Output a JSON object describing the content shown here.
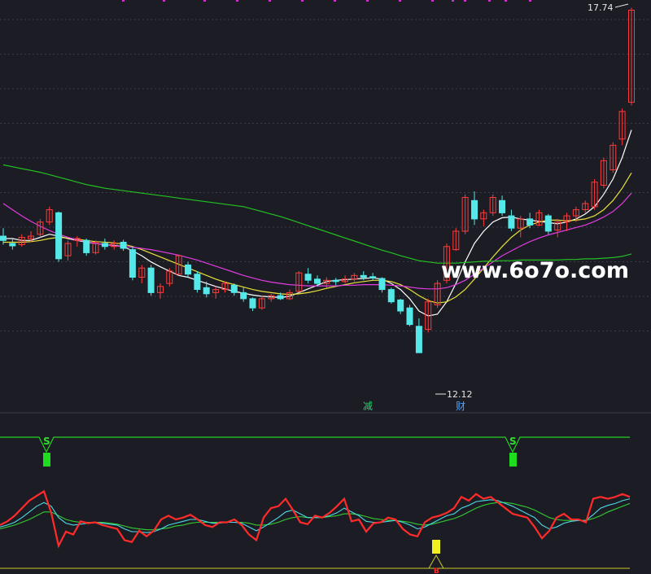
{
  "colors": {
    "background": "#1c1d24",
    "up_candle": "#ff3b3b",
    "down_candle": "#54e8e8",
    "ma5": "#ffffff",
    "ma10": "#e8e23a",
    "ma20": "#e03ce0",
    "ma60": "#22c122",
    "grid": "#3a3c48",
    "osc_main": "#ff2a2a",
    "osc_fast": "#4fd8e6",
    "osc_slow": "#33cc33",
    "signal_line": "#22d022",
    "signal_bar": "#1edc1e",
    "bottom_line": "#c9c92a",
    "bottom_marker": "#f0f020",
    "markers_top": "#cc33cc"
  },
  "labels": {
    "high_price": "17.74",
    "low_price": "12.12",
    "event_1": "减",
    "event_2": "财",
    "signal_1": "S",
    "signal_2": "S",
    "bottom_tag": "B",
    "watermark": "www.6o7o.com"
  },
  "chart_data": [
    {
      "type": "candlestick",
      "title": "",
      "series": [
        {
          "name": "K",
          "kind": "ohlc",
          "values": [
            [
              14.02,
              14.15,
              13.88,
              13.95
            ],
            [
              13.9,
              13.98,
              13.8,
              13.86
            ],
            [
              13.88,
              14.05,
              13.85,
              14.0
            ],
            [
              13.98,
              14.1,
              13.92,
              14.02
            ],
            [
              14.05,
              14.3,
              14.0,
              14.25
            ],
            [
              14.25,
              14.5,
              14.2,
              14.45
            ],
            [
              14.4,
              14.42,
              13.6,
              13.65
            ],
            [
              13.7,
              13.95,
              13.62,
              13.9
            ],
            [
              13.95,
              14.02,
              13.85,
              13.98
            ],
            [
              13.95,
              13.98,
              13.7,
              13.75
            ],
            [
              13.75,
              13.95,
              13.72,
              13.92
            ],
            [
              13.9,
              13.98,
              13.8,
              13.85
            ],
            [
              13.85,
              13.95,
              13.8,
              13.9
            ],
            [
              13.92,
              13.96,
              13.78,
              13.82
            ],
            [
              13.8,
              13.85,
              13.3,
              13.35
            ],
            [
              13.35,
              13.55,
              13.25,
              13.5
            ],
            [
              13.5,
              13.55,
              13.05,
              13.1
            ],
            [
              13.1,
              13.25,
              13.0,
              13.2
            ],
            [
              13.25,
              13.5,
              13.2,
              13.45
            ],
            [
              13.4,
              13.72,
              13.38,
              13.7
            ],
            [
              13.55,
              13.6,
              13.35,
              13.4
            ],
            [
              13.4,
              13.45,
              13.1,
              13.15
            ],
            [
              13.18,
              13.28,
              13.02,
              13.08
            ],
            [
              13.1,
              13.2,
              13.0,
              13.15
            ],
            [
              13.15,
              13.28,
              13.1,
              13.25
            ],
            [
              13.22,
              13.25,
              13.05,
              13.1
            ],
            [
              13.1,
              13.18,
              12.95,
              13.0
            ],
            [
              13.0,
              13.02,
              12.8,
              12.85
            ],
            [
              12.85,
              13.05,
              12.82,
              13.0
            ],
            [
              13.0,
              13.08,
              12.95,
              13.05
            ],
            [
              13.05,
              13.1,
              12.98,
              13.0
            ],
            [
              13.0,
              13.15,
              12.98,
              13.1
            ],
            [
              13.12,
              13.45,
              13.1,
              13.42
            ],
            [
              13.4,
              13.5,
              13.25,
              13.3
            ],
            [
              13.32,
              13.38,
              13.2,
              13.25
            ],
            [
              13.25,
              13.35,
              13.18,
              13.3
            ],
            [
              13.3,
              13.34,
              13.22,
              13.28
            ],
            [
              13.28,
              13.38,
              13.25,
              13.32
            ],
            [
              13.32,
              13.42,
              13.28,
              13.38
            ],
            [
              13.38,
              13.45,
              13.3,
              13.35
            ],
            [
              13.36,
              13.42,
              13.3,
              13.34
            ],
            [
              13.33,
              13.35,
              13.1,
              13.15
            ],
            [
              13.15,
              13.18,
              12.92,
              12.95
            ],
            [
              12.98,
              13.0,
              12.75,
              12.8
            ],
            [
              12.85,
              12.9,
              12.55,
              12.58
            ],
            [
              12.55,
              12.68,
              12.12,
              12.12
            ],
            [
              12.5,
              13.0,
              12.45,
              12.95
            ],
            [
              12.9,
              13.3,
              12.85,
              13.25
            ],
            [
              13.3,
              13.9,
              13.25,
              13.85
            ],
            [
              13.8,
              14.15,
              13.78,
              14.1
            ],
            [
              14.1,
              14.7,
              14.05,
              14.65
            ],
            [
              14.6,
              14.75,
              14.2,
              14.3
            ],
            [
              14.3,
              14.45,
              14.18,
              14.4
            ],
            [
              14.4,
              14.7,
              14.35,
              14.65
            ],
            [
              14.6,
              14.68,
              14.35,
              14.4
            ],
            [
              14.35,
              14.45,
              14.1,
              14.15
            ],
            [
              14.15,
              14.35,
              14.0,
              14.3
            ],
            [
              14.3,
              14.4,
              14.15,
              14.2
            ],
            [
              14.2,
              14.45,
              14.18,
              14.4
            ],
            [
              14.35,
              14.38,
              14.05,
              14.1
            ],
            [
              14.12,
              14.3,
              14.0,
              14.25
            ],
            [
              14.25,
              14.4,
              14.1,
              14.35
            ],
            [
              14.35,
              14.5,
              14.25,
              14.45
            ],
            [
              14.45,
              14.6,
              14.4,
              14.55
            ],
            [
              14.5,
              14.95,
              14.45,
              14.9
            ],
            [
              14.85,
              15.3,
              14.8,
              15.25
            ],
            [
              15.1,
              15.55,
              15.05,
              15.5
            ],
            [
              15.6,
              16.1,
              15.5,
              16.05
            ],
            [
              16.2,
              17.74,
              16.15,
              17.7
            ]
          ]
        },
        {
          "name": "MA5",
          "kind": "line",
          "values": [
            13.98,
            13.98,
            13.95,
            13.95,
            14.0,
            14.05,
            14.02,
            13.98,
            13.95,
            13.92,
            13.9,
            13.88,
            13.87,
            13.85,
            13.78,
            13.7,
            13.6,
            13.52,
            13.45,
            13.38,
            13.35,
            13.3,
            13.25,
            13.2,
            13.16,
            13.12,
            13.09,
            13.06,
            13.04,
            13.03,
            13.02,
            13.04,
            13.1,
            13.16,
            13.22,
            13.28,
            13.3,
            13.31,
            13.32,
            13.33,
            13.34,
            13.32,
            13.25,
            13.15,
            13.0,
            12.8,
            12.72,
            12.75,
            12.95,
            13.25,
            13.6,
            13.9,
            14.1,
            14.25,
            14.32,
            14.33,
            14.3,
            14.28,
            14.26,
            14.24,
            14.22,
            14.25,
            14.3,
            14.38,
            14.5,
            14.7,
            14.95,
            15.3,
            15.75
          ]
        },
        {
          "name": "MA10",
          "kind": "line",
          "values": [
            13.92,
            13.92,
            13.92,
            13.93,
            13.95,
            13.98,
            14.0,
            13.99,
            13.97,
            13.95,
            13.93,
            13.92,
            13.91,
            13.89,
            13.85,
            13.8,
            13.74,
            13.68,
            13.62,
            13.56,
            13.5,
            13.44,
            13.38,
            13.32,
            13.27,
            13.23,
            13.19,
            13.15,
            13.12,
            13.1,
            13.08,
            13.07,
            13.08,
            13.1,
            13.13,
            13.17,
            13.2,
            13.23,
            13.26,
            13.28,
            13.3,
            13.3,
            13.28,
            13.23,
            13.15,
            13.05,
            12.97,
            12.93,
            12.95,
            13.03,
            13.15,
            13.32,
            13.5,
            13.68,
            13.85,
            14.0,
            14.12,
            14.2,
            14.25,
            14.28,
            14.28,
            14.27,
            14.28,
            14.3,
            14.35,
            14.45,
            14.6,
            14.8,
            15.05
          ]
        },
        {
          "name": "MA20",
          "kind": "line",
          "values": [
            14.55,
            14.45,
            14.35,
            14.26,
            14.18,
            14.11,
            14.05,
            14.0,
            13.96,
            13.93,
            13.9,
            13.88,
            13.86,
            13.85,
            13.84,
            13.82,
            13.8,
            13.77,
            13.74,
            13.71,
            13.67,
            13.63,
            13.58,
            13.53,
            13.48,
            13.43,
            13.38,
            13.34,
            13.3,
            13.27,
            13.25,
            13.23,
            13.22,
            13.21,
            13.21,
            13.21,
            13.21,
            13.22,
            13.22,
            13.23,
            13.23,
            13.23,
            13.22,
            13.21,
            13.19,
            13.17,
            13.16,
            13.16,
            13.18,
            13.23,
            13.3,
            13.4,
            13.5,
            13.6,
            13.7,
            13.78,
            13.86,
            13.93,
            13.99,
            14.04,
            14.08,
            14.12,
            14.16,
            14.2,
            14.26,
            14.33,
            14.42,
            14.55,
            14.72
          ]
        },
        {
          "name": "MA60",
          "kind": "line",
          "values": [
            15.18,
            15.15,
            15.12,
            15.09,
            15.06,
            15.02,
            14.98,
            14.94,
            14.9,
            14.86,
            14.83,
            14.8,
            14.78,
            14.76,
            14.74,
            14.72,
            14.7,
            14.68,
            14.66,
            14.64,
            14.62,
            14.6,
            14.58,
            14.56,
            14.54,
            14.52,
            14.5,
            14.46,
            14.42,
            14.38,
            14.34,
            14.29,
            14.24,
            14.19,
            14.14,
            14.09,
            14.04,
            13.99,
            13.94,
            13.89,
            13.84,
            13.79,
            13.75,
            13.7,
            13.66,
            13.62,
            13.6,
            13.58,
            13.58,
            13.58,
            13.59,
            13.6,
            13.61,
            13.61,
            13.62,
            13.62,
            13.63,
            13.63,
            13.63,
            13.63,
            13.63,
            13.64,
            13.64,
            13.65,
            13.65,
            13.66,
            13.67,
            13.69,
            13.73
          ]
        }
      ],
      "annotations": [
        {
          "text": "17.74",
          "index": 68,
          "value": 17.74
        },
        {
          "text": "12.12",
          "index": 45,
          "value": 12.12
        }
      ],
      "ylim": [
        11.5,
        17.8
      ],
      "grid": true
    },
    {
      "type": "line",
      "title": "",
      "series": [
        {
          "name": "main",
          "values": [
            52,
            56,
            62,
            70,
            78,
            83,
            88,
            65,
            30,
            45,
            42,
            56,
            54,
            55,
            52,
            50,
            48,
            36,
            34,
            46,
            40,
            46,
            58,
            62,
            58,
            60,
            63,
            58,
            52,
            50,
            55,
            55,
            58,
            52,
            42,
            36,
            60,
            70,
            72,
            80,
            68,
            55,
            53,
            62,
            60,
            65,
            72,
            80,
            56,
            58,
            45,
            54,
            55,
            60,
            58,
            48,
            42,
            40,
            55,
            60,
            62,
            65,
            70,
            82,
            78,
            85,
            80,
            82,
            76,
            70,
            64,
            62,
            60,
            50,
            38,
            46,
            60,
            64,
            58,
            58,
            55,
            80,
            82,
            80,
            82,
            85,
            82
          ]
        },
        {
          "name": "fast",
          "values": [
            50,
            52,
            55,
            60,
            66,
            72,
            76,
            72,
            60,
            54,
            52,
            53,
            54,
            55,
            54,
            53,
            52,
            48,
            45,
            45,
            44,
            45,
            48,
            52,
            54,
            56,
            58,
            58,
            56,
            54,
            54,
            55,
            55,
            54,
            50,
            46,
            50,
            55,
            60,
            66,
            68,
            64,
            60,
            60,
            60,
            62,
            65,
            70,
            66,
            62,
            56,
            55,
            55,
            56,
            57,
            55,
            52,
            48,
            50,
            54,
            58,
            62,
            64,
            70,
            73,
            77,
            78,
            79,
            78,
            75,
            72,
            68,
            64,
            60,
            52,
            48,
            50,
            54,
            56,
            57,
            57,
            63,
            70,
            73,
            75,
            78,
            80
          ]
        },
        {
          "name": "slow",
          "values": [
            48,
            50,
            52,
            55,
            58,
            62,
            66,
            66,
            62,
            58,
            56,
            55,
            55,
            55,
            55,
            54,
            53,
            51,
            49,
            48,
            47,
            47,
            48,
            49,
            51,
            52,
            54,
            55,
            55,
            55,
            55,
            55,
            55,
            55,
            54,
            52,
            52,
            53,
            55,
            58,
            60,
            61,
            60,
            60,
            60,
            61,
            62,
            64,
            64,
            63,
            61,
            59,
            58,
            57,
            57,
            56,
            55,
            53,
            52,
            53,
            55,
            57,
            59,
            62,
            66,
            70,
            73,
            75,
            76,
            76,
            75,
            73,
            71,
            68,
            64,
            60,
            58,
            57,
            57,
            57,
            57,
            59,
            62,
            66,
            69,
            72,
            75
          ]
        }
      ],
      "markers": [
        {
          "text": "S",
          "index": 13,
          "kind": "sell"
        },
        {
          "text": "S",
          "index": 57,
          "kind": "sell"
        },
        {
          "text": "B",
          "index": 41,
          "kind": "buy"
        }
      ],
      "ylim": [
        0,
        100
      ],
      "grid": false
    }
  ]
}
